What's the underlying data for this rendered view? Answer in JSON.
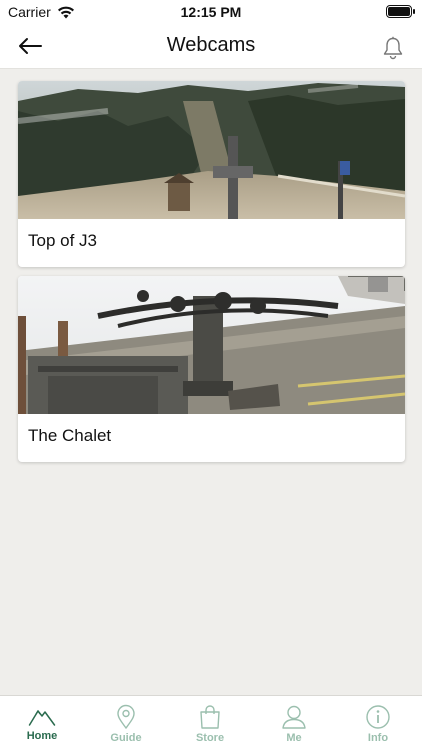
{
  "status_bar": {
    "carrier": "Carrier",
    "time": "12:15 PM"
  },
  "nav": {
    "title": "Webcams",
    "back_icon": "back-arrow-icon",
    "bell_icon": "bell-icon"
  },
  "webcams": [
    {
      "label": "Top of J3"
    },
    {
      "label": "The Chalet"
    }
  ],
  "tabs": [
    {
      "label": "Home",
      "icon": "mountain-icon",
      "active": true
    },
    {
      "label": "Guide",
      "icon": "map-pin-icon",
      "active": false
    },
    {
      "label": "Store",
      "icon": "shopping-bag-icon",
      "active": false
    },
    {
      "label": "Me",
      "icon": "person-icon",
      "active": false
    },
    {
      "label": "Info",
      "icon": "info-icon",
      "active": false
    }
  ],
  "colors": {
    "accent": "#2a6b4e",
    "inactive_tab": "#9bbfae",
    "background": "#efeeeb"
  }
}
